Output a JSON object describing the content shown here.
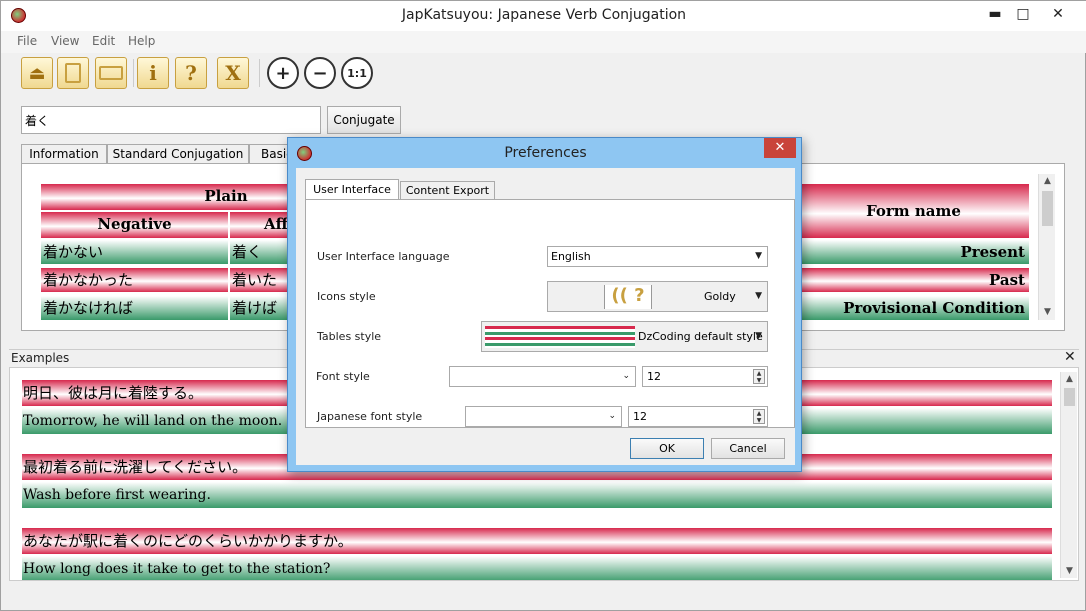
{
  "window": {
    "title": "JapKatsuyou: Japanese Verb Conjugation",
    "minimize": "▬",
    "maximize": "□",
    "close": "✕"
  },
  "menu": [
    "File",
    "View",
    "Edit",
    "Help"
  ],
  "toolbar": {
    "info": "i",
    "help": "?",
    "exit": "X",
    "zoom_in": "+",
    "zoom_out": "−",
    "zoom_reset": "1:1"
  },
  "search": {
    "value": "着く",
    "button": "Conjugate"
  },
  "tabs": [
    "Information",
    "Standard Conjugation",
    "Basic"
  ],
  "table": {
    "plain": "Plain",
    "negative": "Negative",
    "affirmative": "Affi",
    "form_name": "Form name",
    "rows": [
      {
        "neg": "着かない",
        "aff": "着く",
        "form": "Present"
      },
      {
        "neg": "着かなかった",
        "aff": "着いた",
        "form": "Past"
      },
      {
        "neg": "着かなければ",
        "aff": "着けば",
        "form": "Provisional Condition"
      }
    ]
  },
  "examples": {
    "label": "Examples",
    "close": "✕",
    "items": [
      {
        "jp": "明日、彼は月に着陸する。",
        "en": "Tomorrow, he will land on the moon."
      },
      {
        "jp": "最初着る前に洗濯してください。",
        "en": "Wash before first wearing."
      },
      {
        "jp": "あなたが駅に着くのにどのくらいかかりますか。",
        "en": "How long does it take to get to the station?"
      }
    ]
  },
  "dialog": {
    "title": "Preferences",
    "close": "✕",
    "tabs": [
      "User Interface",
      "Content Export"
    ],
    "fields": {
      "language_label": "User Interface language",
      "language_value": "English",
      "icons_label": "Icons style",
      "icons_value": "Goldy",
      "tables_label": "Tables style",
      "tables_value": "DzCoding default style",
      "font_label": "Font style",
      "font_value": "",
      "font_size": "12",
      "jp_font_label": "Japanese font style",
      "jp_font_value": "",
      "jp_font_size": "12"
    },
    "ok": "OK",
    "cancel": "Cancel"
  }
}
